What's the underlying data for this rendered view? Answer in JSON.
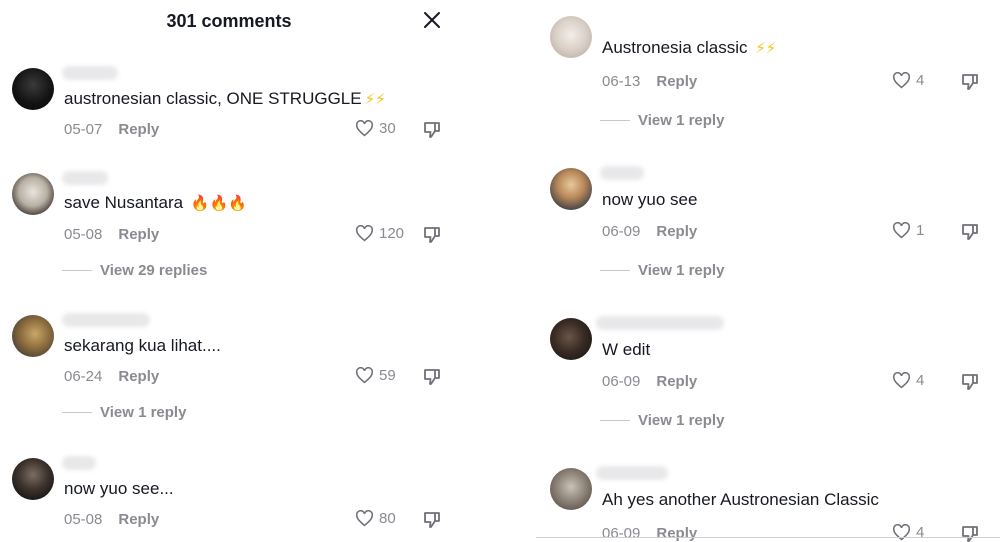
{
  "header": {
    "title": "301 comments"
  },
  "icons": {
    "close": "close-icon",
    "like": "heart-icon",
    "dislike": "thumbs-down-icon"
  },
  "colors": {
    "text": "#161823",
    "muted": "#8a8b91",
    "bolt": "#f5c518",
    "fire": "#f26b1d"
  },
  "left_comments": [
    {
      "text": "austronesian classic, ONE STRUGGLE",
      "emoji": "⚡⚡",
      "date": "05-07",
      "reply": "Reply",
      "likes": "30",
      "view_replies": ""
    },
    {
      "text": "save Nusantara",
      "emoji": "🔥🔥🔥",
      "date": "05-08",
      "reply": "Reply",
      "likes": "120",
      "view_replies": "View 29 replies"
    },
    {
      "text": "sekarang kua lihat....",
      "emoji": "",
      "date": "06-24",
      "reply": "Reply",
      "likes": "59",
      "view_replies": "View 1 reply"
    },
    {
      "text": "now yuo see...",
      "emoji": "",
      "date": "05-08",
      "reply": "Reply",
      "likes": "80",
      "view_replies": ""
    }
  ],
  "right_comments": [
    {
      "text": "Austronesia classic",
      "emoji": "⚡⚡",
      "date": "06-13",
      "reply": "Reply",
      "likes": "4",
      "view_replies": "View 1 reply"
    },
    {
      "text": "now yuo see",
      "emoji": "",
      "date": "06-09",
      "reply": "Reply",
      "likes": "1",
      "view_replies": "View 1 reply"
    },
    {
      "text": "W edit",
      "emoji": "",
      "date": "06-09",
      "reply": "Reply",
      "likes": "4",
      "view_replies": "View 1 reply"
    },
    {
      "text": "Ah yes another Austronesian Classic",
      "emoji": "",
      "date": "06-09",
      "reply": "Reply",
      "likes": "4",
      "view_replies": ""
    }
  ]
}
